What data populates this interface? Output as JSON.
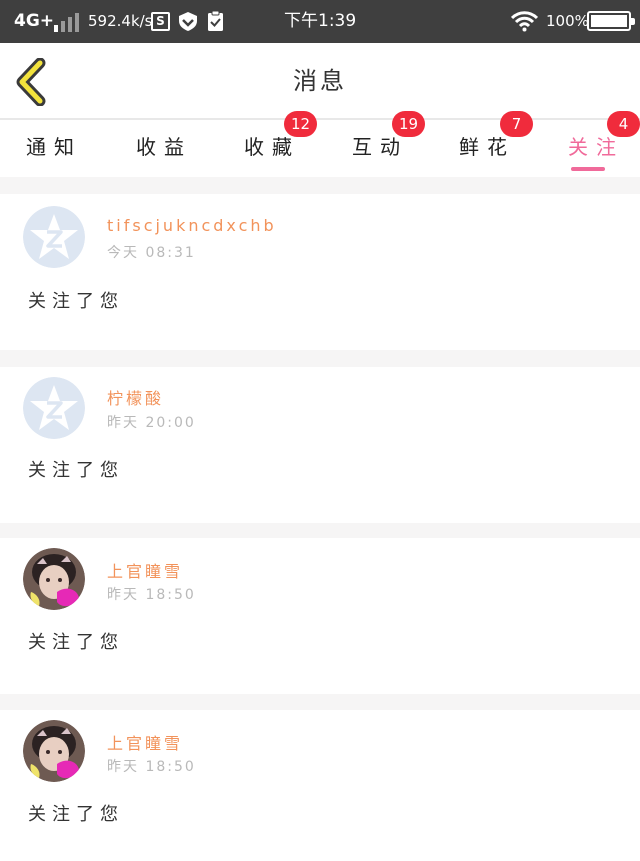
{
  "status_bar": {
    "network": "4G+",
    "speed": "592.4k/s",
    "s_icon_label": "S",
    "time": "下午1:39",
    "battery_text": "100%",
    "battery_level": 1.0
  },
  "header": {
    "title": "消息"
  },
  "tabs": [
    {
      "label": "通知",
      "badge": ""
    },
    {
      "label": "收益",
      "badge": ""
    },
    {
      "label": "收藏",
      "badge": "12"
    },
    {
      "label": "互动",
      "badge": "19"
    },
    {
      "label": "鲜花",
      "badge": "7"
    },
    {
      "label": "关注",
      "badge": "4",
      "active": true
    }
  ],
  "messages": [
    {
      "name": "tifscjukncdxchb",
      "time": "今天 08:31",
      "text": "关注了您",
      "avatar": "qq-default-icon"
    },
    {
      "name": "柠檬酸",
      "time": "昨天 20:00",
      "text": "关注了您",
      "avatar": "qq-default-icon"
    },
    {
      "name": "上官瞳雪",
      "time": "昨天 18:50",
      "text": "关注了您",
      "avatar": "user-photo"
    },
    {
      "name": "上官瞳雪",
      "time": "昨天 18:50",
      "text": "关注了您",
      "avatar": "user-photo"
    }
  ],
  "colors": {
    "accent_pink": "#f06a9a",
    "badge_red": "#f02b3c",
    "name_orange": "#f2935b",
    "back_arrow_yellow": "#f3e33c"
  }
}
